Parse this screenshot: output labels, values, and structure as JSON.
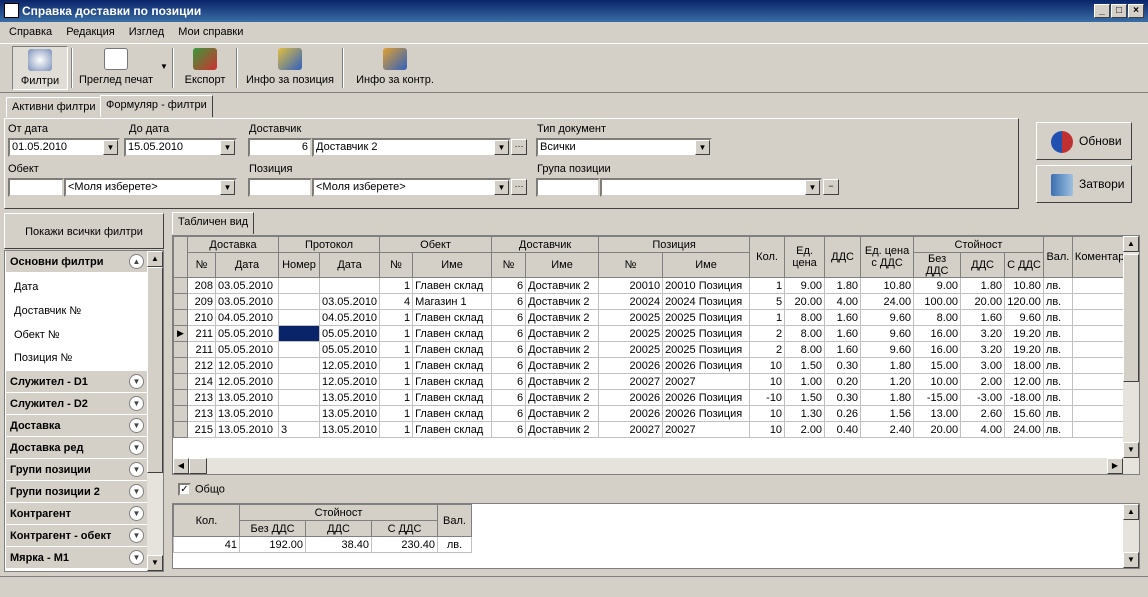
{
  "window": {
    "title": "Справка доставки по позиции",
    "controls": [
      "_",
      "□",
      "×"
    ]
  },
  "menu": [
    "Справка",
    "Редакция",
    "Изглед",
    "Мои справки"
  ],
  "toolbar": {
    "filters": "Филтри",
    "print_preview": "Преглед печат",
    "export": "Експорт",
    "position_info": "Инфо за позиция",
    "contractor_info": "Инфо за контр."
  },
  "filter_tabs": [
    "Активни филтри",
    "Формуляр - филтри"
  ],
  "filters": {
    "from_date_label": "От дата",
    "from_date": "01.05.2010",
    "to_date_label": "До дата",
    "to_date": "15.05.2010",
    "supplier_label": "Доставчик",
    "supplier_no": "6",
    "supplier_name": "Доставчик 2",
    "doc_type_label": "Тип документ",
    "doc_type": "Всички",
    "object_label": "Обект",
    "object_no": "",
    "object_name": "<Моля изберете>",
    "position_label": "Позиция",
    "position_no": "",
    "position_name": "<Моля изберете>",
    "position_group_label": "Група позиции",
    "position_group_no": "",
    "position_group_name": ""
  },
  "buttons": {
    "refresh": "Обнови",
    "close": "Затвори"
  },
  "left_panel": {
    "show_all": "Покажи всички филтри",
    "main_header": "Основни филтри",
    "main_items": [
      "Дата",
      "Доставчик №",
      "Обект №",
      "Позиция №"
    ],
    "groups": [
      "Служител - D1",
      "Служител - D2",
      "Доставка",
      "Доставка ред",
      "Групи позиции",
      "Групи позиции 2",
      "Контрагент",
      "Контрагент - обект",
      "Мярка - М1"
    ]
  },
  "grid_tab": "Табличен вид",
  "grid": {
    "group_headers": [
      "Доставка",
      "Протокол",
      "Обект",
      "Доставчик",
      "Позиция",
      "Кол.",
      "Ед. цена",
      "ДДС",
      "Ед. цена с ДДС",
      "Стойност",
      "Вал.",
      "Коментар"
    ],
    "sub_headers": [
      "№",
      "Дата",
      "Номер",
      "Дата",
      "№",
      "Име",
      "№",
      "Име",
      "№",
      "Име",
      "Без ДДС",
      "ДДС",
      "С ДДС"
    ],
    "rows": [
      [
        "208",
        "03.05.2010",
        "",
        "",
        "1",
        "Главен склад",
        "6",
        "Доставчик 2",
        "20010",
        "20010 Позиция",
        "1",
        "9.00",
        "1.80",
        "10.80",
        "9.00",
        "1.80",
        "10.80",
        "лв.",
        ""
      ],
      [
        "209",
        "03.05.2010",
        "",
        "03.05.2010",
        "4",
        "Магазин 1",
        "6",
        "Доставчик 2",
        "20024",
        "20024 Позиция",
        "5",
        "20.00",
        "4.00",
        "24.00",
        "100.00",
        "20.00",
        "120.00",
        "лв.",
        ""
      ],
      [
        "210",
        "04.05.2010",
        "",
        "04.05.2010",
        "1",
        "Главен склад",
        "6",
        "Доставчик 2",
        "20025",
        "20025 Позиция",
        "1",
        "8.00",
        "1.60",
        "9.60",
        "8.00",
        "1.60",
        "9.60",
        "лв.",
        ""
      ],
      [
        "211",
        "05.05.2010",
        "",
        "05.05.2010",
        "1",
        "Главен склад",
        "6",
        "Доставчик 2",
        "20025",
        "20025 Позиция",
        "2",
        "8.00",
        "1.60",
        "9.60",
        "16.00",
        "3.20",
        "19.20",
        "лв.",
        ""
      ],
      [
        "211",
        "05.05.2010",
        "",
        "05.05.2010",
        "1",
        "Главен склад",
        "6",
        "Доставчик 2",
        "20025",
        "20025 Позиция",
        "2",
        "8.00",
        "1.60",
        "9.60",
        "16.00",
        "3.20",
        "19.20",
        "лв.",
        ""
      ],
      [
        "212",
        "12.05.2010",
        "",
        "12.05.2010",
        "1",
        "Главен склад",
        "6",
        "Доставчик 2",
        "20026",
        "20026 Позиция",
        "10",
        "1.50",
        "0.30",
        "1.80",
        "15.00",
        "3.00",
        "18.00",
        "лв.",
        ""
      ],
      [
        "214",
        "12.05.2010",
        "",
        "12.05.2010",
        "1",
        "Главен склад",
        "6",
        "Доставчик 2",
        "20027",
        "20027",
        "10",
        "1.00",
        "0.20",
        "1.20",
        "10.00",
        "2.00",
        "12.00",
        "лв.",
        ""
      ],
      [
        "213",
        "13.05.2010",
        "",
        "13.05.2010",
        "1",
        "Главен склад",
        "6",
        "Доставчик 2",
        "20026",
        "20026 Позиция",
        "-10",
        "1.50",
        "0.30",
        "1.80",
        "-15.00",
        "-3.00",
        "-18.00",
        "лв.",
        ""
      ],
      [
        "213",
        "13.05.2010",
        "",
        "13.05.2010",
        "1",
        "Главен склад",
        "6",
        "Доставчик 2",
        "20026",
        "20026 Позиция",
        "10",
        "1.30",
        "0.26",
        "1.56",
        "13.00",
        "2.60",
        "15.60",
        "лв.",
        ""
      ],
      [
        "215",
        "13.05.2010",
        "3",
        "13.05.2010",
        "1",
        "Главен склад",
        "6",
        "Доставчик 2",
        "20027",
        "20027",
        "10",
        "2.00",
        "0.40",
        "2.40",
        "20.00",
        "4.00",
        "24.00",
        "лв.",
        ""
      ]
    ],
    "current_row": 3
  },
  "summary": {
    "checkbox_label": "Общо",
    "checked": true,
    "headers": {
      "qty": "Кол.",
      "value": "Стойност",
      "no_vat": "Без ДДС",
      "vat": "ДДС",
      "with_vat": "С ДДС",
      "currency": "Вал."
    },
    "values": {
      "qty": "41",
      "no_vat": "192.00",
      "vat": "38.40",
      "with_vat": "230.40",
      "currency": "лв."
    }
  }
}
